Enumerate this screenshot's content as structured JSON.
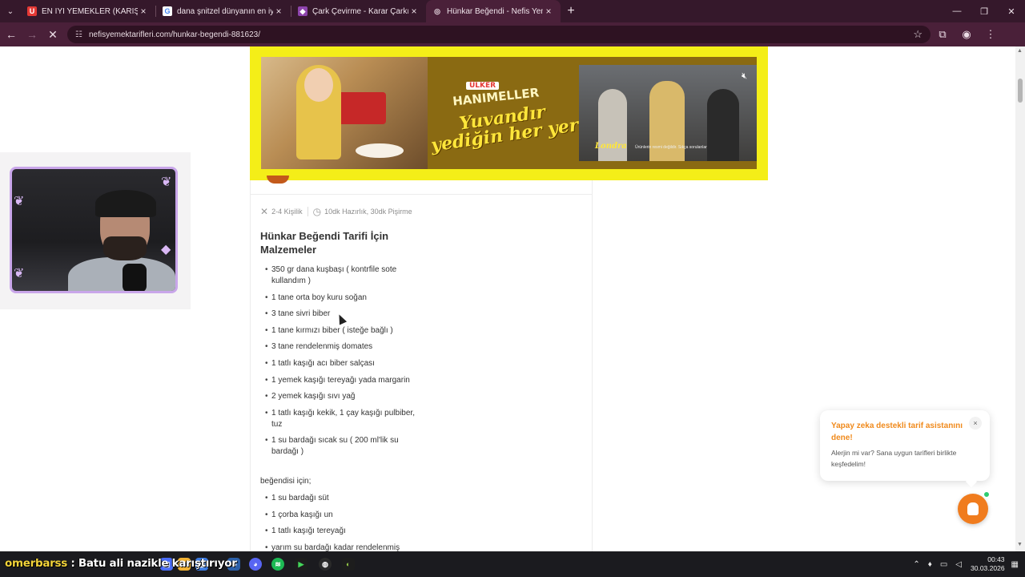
{
  "tabs": [
    {
      "label": "EN İYİ YEMEKLER (KARIŞIK) | Un",
      "favicon_text": "U",
      "favicon_color": "#e53935"
    },
    {
      "label": "dana şnitzel dünyanın en iyi yem",
      "favicon_text": "G",
      "favicon_color": "#ffffff"
    },
    {
      "label": "Çark Çevirme - Karar Çarkı",
      "favicon_text": "◆",
      "favicon_color": "#8e44ad"
    },
    {
      "label": "Hünkar Beğendi - Nefis Yemek",
      "favicon_text": "◎",
      "favicon_color": "#d35400"
    }
  ],
  "address": {
    "url": "nefisyemektarifleri.com/hunkar-begendi-881623/"
  },
  "ad": {
    "brand": "ÜLKER",
    "product": "HANIMELLER",
    "slogan_line1": "Yuvandır",
    "slogan_line2": "yediğin her yer",
    "city": "Londra",
    "caption": "Ürünlerin resmi değildir. Sıkça sorulanlar"
  },
  "recipe": {
    "servings": "2-4 Kişilik",
    "time": "10dk Hazırlık, 30dk Pişirme",
    "title": "Hünkar Beğendi Tarifi İçin Malzemeler",
    "ingredients": [
      "350 gr dana kuşbaşı ( kontrfile sote kullandım )",
      "1 tane orta boy kuru soğan",
      "3 tane sivri biber",
      "1 tane kırmızı biber ( isteğe bağlı )",
      "3 tane rendelenmiş domates",
      "1 tatlı kaşığı acı biber salçası",
      "1 yemek kaşığı tereyağı yada margarin",
      "2 yemek kaşığı sıvı yağ",
      "1 tatlı kaşığı kekik, 1 çay kaşığı pulbiber, tuz",
      "1 su bardağı sıcak su ( 200 ml'lik su bardağı )"
    ],
    "begendi_heading": "beğendisi için;",
    "begendi_ingredients": [
      "1 su bardağı süt",
      "1 çorba kaşığı un",
      "1 tatlı kaşığı tereyağı",
      "yarım su bardağı kadar rendelenmiş"
    ]
  },
  "assistant": {
    "title": "Yapay zeka destekli tarif asistanını dene!",
    "body": "Alerjin mi var? Sana uygun tarifleri birlikte keşfedelim!",
    "close": "×"
  },
  "overlay": {
    "nick": "omerbarss",
    "message": " : Batu ali nazikle karıştırıyor"
  },
  "clock": {
    "time": "00:43",
    "date": "30.03.2026"
  },
  "colors": {
    "accent": "#f08a1c",
    "ad_bg": "#f4ee18",
    "tabbar": "#35182b"
  }
}
